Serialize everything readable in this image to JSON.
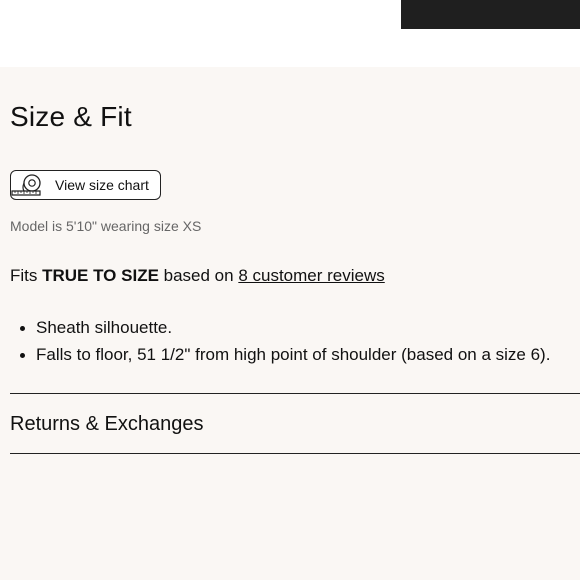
{
  "header": {
    "product_image_alt": ""
  },
  "size_fit": {
    "title": "Size & Fit",
    "size_chart_button": "View size chart",
    "model_note": "Model is 5'10\" wearing size XS",
    "fit_prefix": "Fits ",
    "fit_value": "TRUE TO SIZE",
    "fit_middle": " based on ",
    "reviews_link": "8 customer reviews",
    "details": [
      "Sheath silhouette.",
      "Falls to floor, 51 1/2\" from high point of shoulder (based on a size 6)."
    ]
  },
  "returns": {
    "label": "Returns & Exchanges"
  },
  "icons": {
    "size_chart": "measuring-tape-icon"
  },
  "colors": {
    "panel_bg": "#faf7f4",
    "text": "#111111",
    "muted": "#666666"
  }
}
